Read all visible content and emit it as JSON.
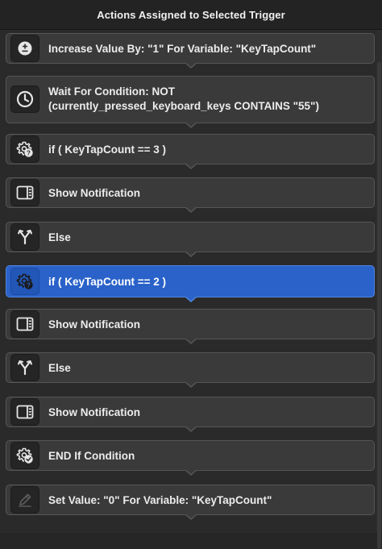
{
  "window": {
    "title": "Actions Assigned to Selected Trigger"
  },
  "actions": [
    {
      "label": "Increase Value By: \"1\" For Variable: \"KeyTapCount\"",
      "icon": "plus-minus-icon",
      "selected": false
    },
    {
      "label": "Wait For Condition: NOT",
      "label2": "(currently_pressed_keyboard_keys CONTAINS \"55\")",
      "icon": "clock-icon",
      "selected": false
    },
    {
      "label": "if ( KeyTapCount == 3 )",
      "icon": "gear-question-icon",
      "selected": false
    },
    {
      "label": "Show Notification",
      "icon": "notification-panel-icon",
      "selected": false
    },
    {
      "label": "Else",
      "icon": "branch-icon",
      "selected": false
    },
    {
      "label": "if ( KeyTapCount == 2 )",
      "icon": "gear-question-icon",
      "selected": true
    },
    {
      "label": "Show Notification",
      "icon": "notification-panel-icon",
      "selected": false
    },
    {
      "label": "Else",
      "icon": "branch-icon",
      "selected": false
    },
    {
      "label": "Show Notification",
      "icon": "notification-panel-icon",
      "selected": false
    },
    {
      "label": "END If Condition",
      "icon": "gear-check-icon",
      "selected": false
    },
    {
      "label": "Set Value: \"0\" For Variable: \"KeyTapCount\"",
      "icon": "pencil-icon",
      "selected": false
    }
  ],
  "colors": {
    "selected": "#2a62c9",
    "row": "#3a3a3a",
    "background": "#262626"
  }
}
